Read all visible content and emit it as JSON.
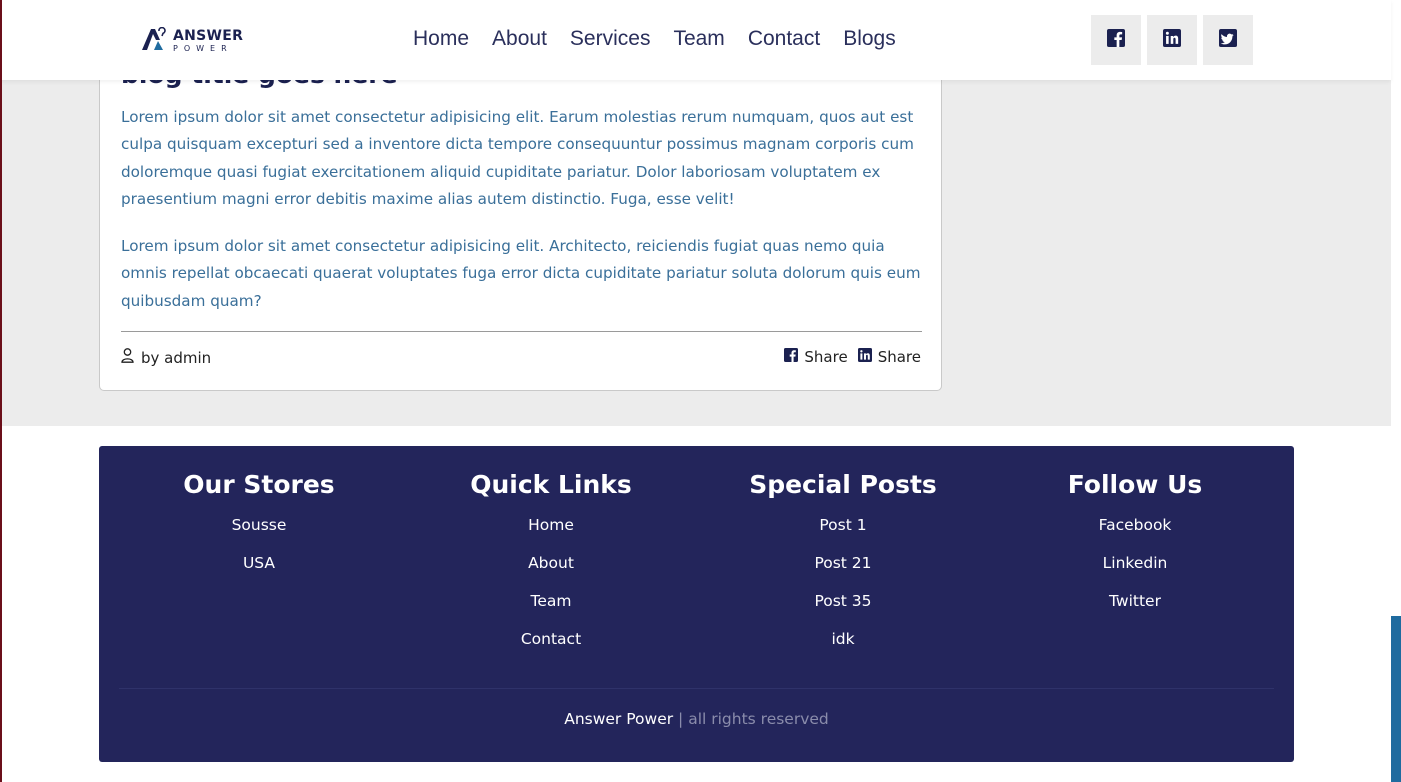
{
  "header": {
    "logo": {
      "name": "ANSWER",
      "tagline": "POWER"
    },
    "nav": [
      "Home",
      "About",
      "Services",
      "Team",
      "Contact",
      "Blogs"
    ],
    "social_icons": [
      "facebook-icon",
      "linkedin-icon",
      "twitter-icon"
    ]
  },
  "blog": {
    "title_partial": "blog title goes here",
    "paragraphs": [
      "Lorem ipsum dolor sit amet consectetur adipisicing elit. Earum molestias rerum numquam, quos aut est culpa quisquam excepturi sed a inventore dicta tempore consequuntur possimus magnam corporis cum doloremque quasi fugiat exercitationem aliquid cupiditate pariatur. Dolor laboriosam voluptatem ex praesentium magni error debitis maxime alias autem distinctio. Fuga, esse velit!",
      "Lorem ipsum dolor sit amet consectetur adipisicing elit. Architecto, reiciendis fugiat quas nemo quia omnis repellat obcaecati quaerat voluptates fuga error dicta cupiditate pariatur soluta dolorum quis eum quibusdam quam?"
    ],
    "author": "by admin",
    "share": [
      {
        "icon": "facebook-icon",
        "label": "Share"
      },
      {
        "icon": "linkedin-icon",
        "label": "Share"
      }
    ]
  },
  "footer": {
    "columns": [
      {
        "title": "Our Stores",
        "items": [
          "Sousse",
          "USA"
        ]
      },
      {
        "title": "Quick Links",
        "items": [
          "Home",
          "About",
          "Team",
          "Contact"
        ]
      },
      {
        "title": "Special Posts",
        "items": [
          "Post 1",
          "Post 21",
          "Post 35",
          "idk"
        ]
      },
      {
        "title": "Follow Us",
        "items": [
          "Facebook",
          "Linkedin",
          "Twitter"
        ]
      }
    ],
    "copyright_brand": "Answer Power",
    "copyright_rest": "| all rights reserved"
  },
  "colors": {
    "navy": "#23255b",
    "heading": "#1b2150",
    "body_text": "#3a6f99",
    "page_band": "#ececec",
    "accent_blue": "#1f6b9f"
  }
}
